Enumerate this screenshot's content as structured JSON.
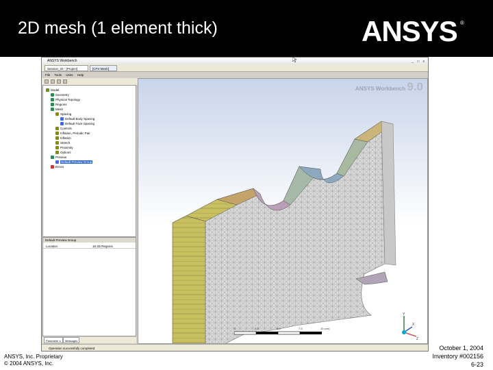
{
  "slide": {
    "title": "2D mesh (1 element thick)",
    "logo_text": "ANSYS",
    "footer_left_line1": "ANSYS, Inc. Proprietary",
    "footer_left_line2": "© 2004 ANSYS, Inc.",
    "footer_right_line1": "October 1, 2004",
    "footer_right_line2": "Inventory #002156",
    "footer_right_line3": "6-23"
  },
  "window": {
    "title": "ANSYS Workbench",
    "tabs": [
      "Session_20 - [Project]",
      "[CFX-Mesh]"
    ],
    "menu": [
      "File",
      "Tools",
      "Units",
      "Help"
    ],
    "controls": "_ □ x"
  },
  "tree": {
    "items": [
      {
        "label": "Model",
        "indent": 0,
        "color": "#6b8e23"
      },
      {
        "label": "Geometry",
        "indent": 1,
        "color": "#2e8b57"
      },
      {
        "label": "Physical Topology",
        "indent": 1,
        "color": "#2e8b57"
      },
      {
        "label": "Regions",
        "indent": 1,
        "color": "#2e8b57"
      },
      {
        "label": "Mesh",
        "indent": 1,
        "color": "#2e8b57"
      },
      {
        "label": "Spacing",
        "indent": 2,
        "color": "#8b8b00"
      },
      {
        "label": "Default Body Spacing",
        "indent": 3,
        "color": "#4169e1"
      },
      {
        "label": "Default Face Spacing",
        "indent": 3,
        "color": "#4169e1"
      },
      {
        "label": "Controls",
        "indent": 2,
        "color": "#8b8b00"
      },
      {
        "label": "Inflation, Periodic Pair",
        "indent": 2,
        "color": "#8b8b00"
      },
      {
        "label": "Inflation",
        "indent": 2,
        "color": "#8b8b00"
      },
      {
        "label": "Stretch",
        "indent": 2,
        "color": "#8b8b00"
      },
      {
        "label": "Proximity",
        "indent": 2,
        "color": "#8b8b00"
      },
      {
        "label": "Options",
        "indent": 2,
        "color": "#8b8b00"
      },
      {
        "label": "Preview",
        "indent": 1,
        "color": "#2e8b57"
      },
      {
        "label": "Default Preview Group",
        "indent": 2,
        "color": "#4169e1",
        "selected": true
      },
      {
        "label": "Errors",
        "indent": 1,
        "color": "#cc3333"
      }
    ]
  },
  "details": {
    "header": "Default Preview Group",
    "key": "Location",
    "value": "16 2D Regions"
  },
  "bottom_tabs": [
    "Parameter s",
    "Messages"
  ],
  "status": "Operation successfully completed",
  "viewport": {
    "brand": "ANSYS Workbench",
    "version": "9.0",
    "scale_labels": [
      "0",
      "2.5",
      "5.0",
      "7.5",
      "10 (cm)"
    ],
    "axis_y": "Y",
    "axis_x": "X",
    "axis_z": "Z"
  }
}
